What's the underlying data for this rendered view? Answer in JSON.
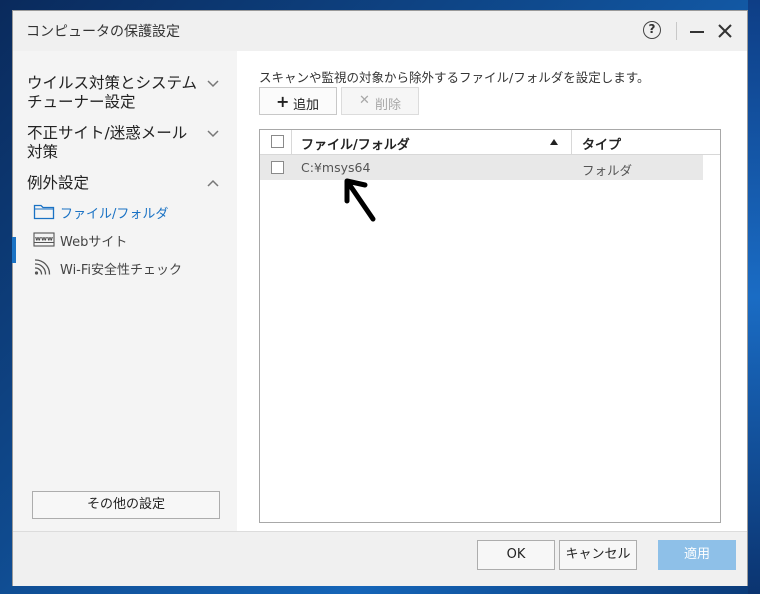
{
  "window": {
    "title": "コンピュータの保護設定",
    "help_label": "?"
  },
  "sidebar": {
    "groups": [
      {
        "label_line1": "ウイルス対策とシステム",
        "label_line2": "チューナー設定",
        "expanded": false
      },
      {
        "label_line1": "不正サイト/迷惑メール",
        "label_line2": "対策",
        "expanded": false
      },
      {
        "label_line1": "例外設定",
        "label_line2": "",
        "expanded": true
      }
    ],
    "items": [
      {
        "label": "ファイル/フォルダ",
        "icon": "folder-icon",
        "active": true
      },
      {
        "label": "Webサイト",
        "icon": "www-icon",
        "active": false
      },
      {
        "label": "Wi-Fi安全性チェック",
        "icon": "wifi-icon",
        "active": false
      }
    ],
    "other_settings_label": "その他の設定"
  },
  "main": {
    "description": "スキャンや監視の対象から除外するファイル/フォルダを設定します。",
    "add_label": "追加",
    "delete_label": "削除",
    "table": {
      "columns": [
        "ファイル/フォルダ",
        "タイプ"
      ],
      "sort_column": "ファイル/フォルダ",
      "sort_direction": "ascending",
      "rows": [
        {
          "path": "C:¥msys64",
          "type": "フォルダ",
          "checked": false,
          "selected": true
        }
      ]
    }
  },
  "footer": {
    "ok_label": "OK",
    "cancel_label": "キャンセル",
    "apply_label": "適用"
  },
  "colors": {
    "accent": "#1a72c4",
    "apply_disabled": "#8ec0e8"
  }
}
